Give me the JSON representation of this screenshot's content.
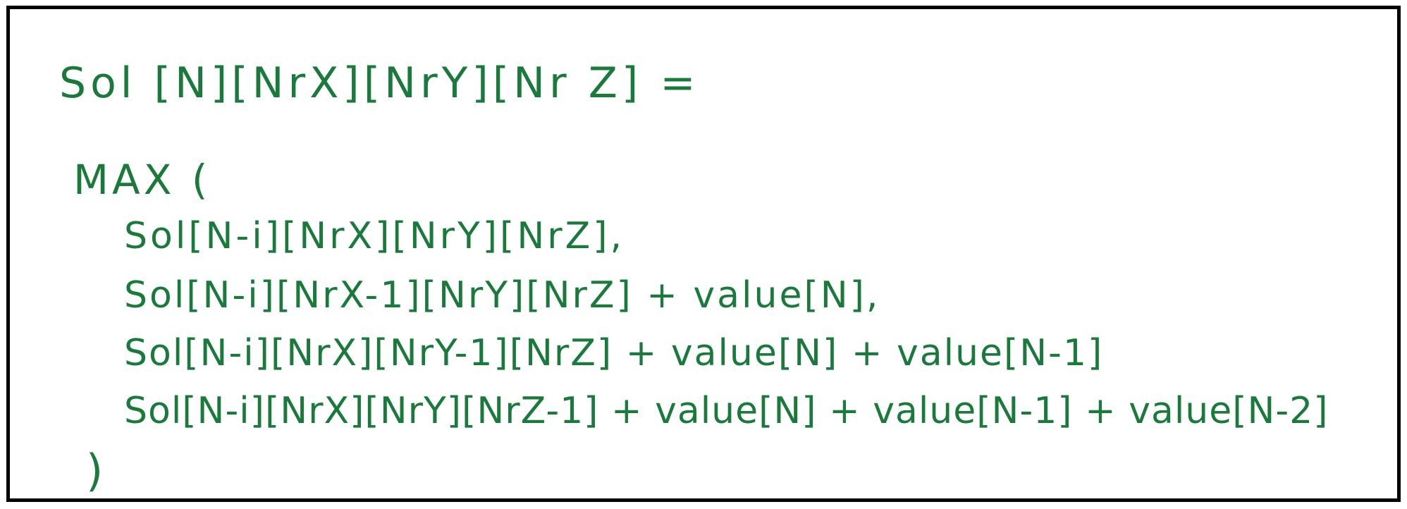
{
  "formula": {
    "head": "Sol [N][NrX][NrY][Nr Z]   =",
    "max_open": "MAX (",
    "terms": [
      "Sol[N-i][NrX][NrY][NrZ],",
      "Sol[N-i][NrX-1][NrY][NrZ] + value[N],",
      "Sol[N-i][NrX][NrY-1][NrZ] + value[N] + value[N-1]",
      "Sol[N-i][NrX][NrY][NrZ-1] + value[N] + value[N-1] + value[N-2]"
    ],
    "max_close": ")"
  },
  "colors": {
    "ink": "#1a7a3c",
    "border": "#000000",
    "background": "#ffffff"
  }
}
